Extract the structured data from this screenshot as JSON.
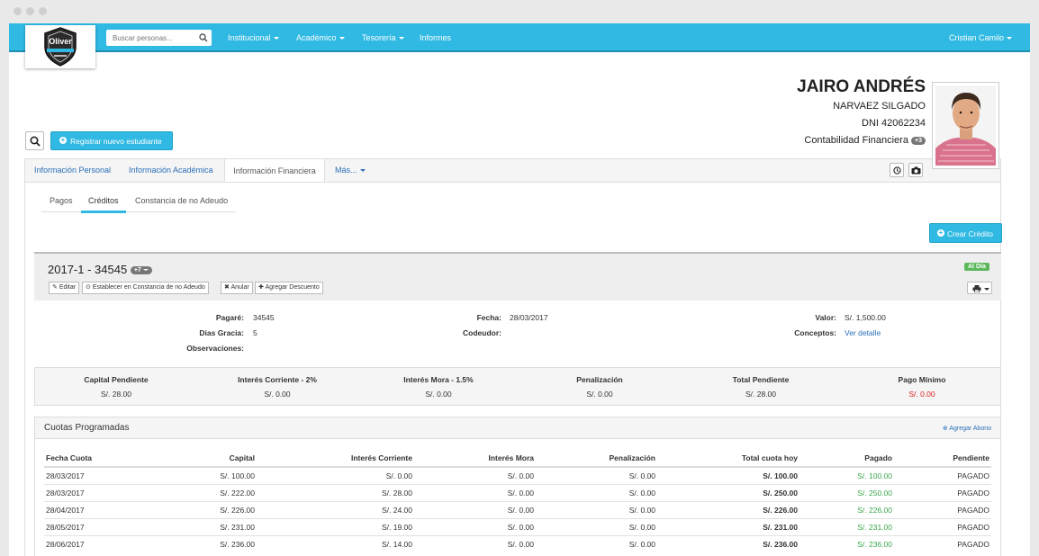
{
  "navbar": {
    "logo_text": "Oliver",
    "search_placeholder": "Buscar personas...",
    "menu": [
      {
        "label": "Institucional",
        "dropdown": true
      },
      {
        "label": "Académico",
        "dropdown": true
      },
      {
        "label": "Tesorería",
        "dropdown": true
      },
      {
        "label": "Informes",
        "dropdown": false
      }
    ],
    "user": "Cristian Camilo"
  },
  "actions": {
    "register_label": "Registrar nuevo estudiante"
  },
  "profile": {
    "first_name": "JAIRO ANDRÉS",
    "last_name": "NARVAEZ SILGADO",
    "dni": "DNI 42062234",
    "program": "Contabilidad Financiera",
    "program_badge": "+3"
  },
  "tabs": {
    "items": [
      "Información Personal",
      "Información Académica",
      "Información Financiera",
      "Más..."
    ],
    "active": "Información Financiera"
  },
  "subtabs": {
    "items": [
      "Pagos",
      "Créditos",
      "Constancia de no Adeudo"
    ],
    "active": "Créditos"
  },
  "create_credit_label": "Crear Crédito",
  "credit": {
    "title": "2017-1 - 34545",
    "badge": "+7",
    "status": "Al Día",
    "buttons": [
      "Editar",
      "Establecer en Constancia de no Adeudo",
      "Anular",
      "Agregar Descuento"
    ],
    "details": {
      "pagare_label": "Pagaré:",
      "pagare": "34545",
      "dias_label": "Días Gracia:",
      "dias": "5",
      "obs_label": "Observaciones:",
      "obs": "",
      "fecha_label": "Fecha:",
      "fecha": "28/03/2017",
      "codeudor_label": "Codeudor:",
      "codeudor": "",
      "valor_label": "Valor:",
      "valor": "S/. 1,500.00",
      "conceptos_label": "Conceptos:",
      "conceptos": "Ver detalle"
    }
  },
  "summary": [
    {
      "label": "Capital Pendiente",
      "value": "S/. 28.00",
      "color": "#333333"
    },
    {
      "label": "Interés Corriente - 2%",
      "value": "S/. 0.00",
      "color": "#333333"
    },
    {
      "label": "Interés Mora - 1.5%",
      "value": "S/. 0.00",
      "color": "#333333"
    },
    {
      "label": "Penalización",
      "value": "S/. 0.00",
      "color": "#333333"
    },
    {
      "label": "Total Pendiente",
      "value": "S/. 28.00",
      "color": "#333333"
    },
    {
      "label": "Pago Mínimo",
      "value": "S/. 0.00",
      "color": "#e02020"
    }
  ],
  "cuotas": {
    "title": "Cuotas Programadas",
    "add_label": "Agregar Abono",
    "columns": [
      "Fecha Cuota",
      "Capital",
      "Interés Corriente",
      "Interés Mora",
      "Penalización",
      "Total cuota hoy",
      "Pagado",
      "Pendiente"
    ],
    "rows": [
      [
        "28/03/2017",
        "S/. 100.00",
        "S/. 0.00",
        "S/. 0.00",
        "S/. 0.00",
        "S/. 100.00",
        "S/. 100.00",
        "PAGADO"
      ],
      [
        "28/03/2017",
        "S/. 222.00",
        "S/. 28.00",
        "S/. 0.00",
        "S/. 0.00",
        "S/. 250.00",
        "S/. 250.00",
        "PAGADO"
      ],
      [
        "28/04/2017",
        "S/. 226.00",
        "S/. 24.00",
        "S/. 0.00",
        "S/. 0.00",
        "S/. 226.00",
        "S/. 226.00",
        "PAGADO"
      ],
      [
        "28/05/2017",
        "S/. 231.00",
        "S/. 19.00",
        "S/. 0.00",
        "S/. 0.00",
        "S/. 231.00",
        "S/. 231.00",
        "PAGADO"
      ],
      [
        "28/06/2017",
        "S/. 236.00",
        "S/. 14.00",
        "S/. 0.00",
        "S/. 0.00",
        "S/. 236.00",
        "S/. 236.00",
        "PAGADO"
      ]
    ]
  }
}
